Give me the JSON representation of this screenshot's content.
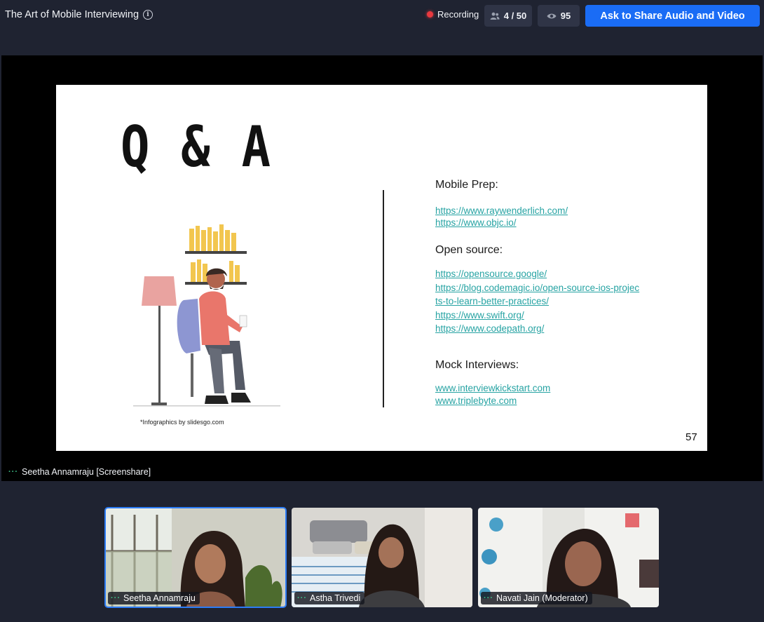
{
  "header": {
    "title": "The Art of Mobile Interviewing",
    "recording_label": "Recording",
    "participants": "4 / 50",
    "viewers": "95",
    "share_button": "Ask to Share Audio and Video"
  },
  "screenshare": {
    "label": "Seetha Annamraju [Screenshare]",
    "slide": {
      "title": "Q & A",
      "sections": [
        {
          "heading": "Mobile Prep:",
          "links": [
            "https://www.raywenderlich.com/",
            "https://www.objc.io/"
          ]
        },
        {
          "heading": "Open source:",
          "links": [
            "https://opensource.google/",
            "https://blog.codemagic.io/open-source-ios-projec",
            "ts-to-learn-better-practices/",
            "https://www.swift.org/",
            "https://www.codepath.org/"
          ]
        },
        {
          "heading": "Mock Interviews:",
          "links": [
            "www.interviewkickstart.com",
            "www.triplebyte.com"
          ]
        }
      ],
      "credit": "*Infographics by slidesgo.com",
      "page_number": "57"
    }
  },
  "participants": [
    {
      "name": "Seetha Annamraju",
      "active": true
    },
    {
      "name": "Astha Trivedi",
      "active": false
    },
    {
      "name": "Navati Jain (Moderator)",
      "active": false
    }
  ],
  "colors": {
    "background": "#1f2331",
    "accent": "#1a6cf5",
    "recording": "#e8393f",
    "link": "#26a3a3",
    "speaking_dots": "#3ec28a"
  },
  "icons": [
    "info-icon",
    "recording-dot-icon",
    "people-icon",
    "eye-icon",
    "speaking-dots-icon"
  ]
}
